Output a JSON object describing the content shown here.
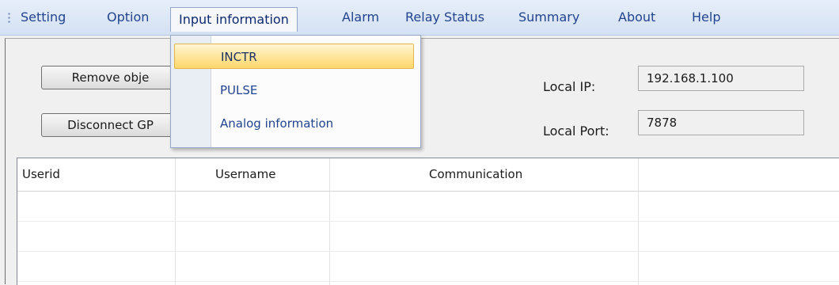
{
  "menubar": {
    "items": [
      "Setting",
      "Option",
      "Input information",
      "Alarm",
      "Relay Status",
      "Summary",
      "About",
      "Help"
    ]
  },
  "dropdown": {
    "items": [
      "INCTR",
      "PULSE",
      "Analog information"
    ],
    "highlighted": "INCTR"
  },
  "toolbar": {
    "remove_button": "Remove  obje",
    "disconnect_button": "Disconnect GP"
  },
  "network": {
    "local_ip_label": "Local   IP:",
    "local_ip_value": "192.168.1.100",
    "local_port_label": "Local Port:",
    "local_port_value": "7878"
  },
  "grid": {
    "columns": [
      "Userid",
      "Username",
      "Communication",
      ""
    ],
    "rows": [
      [
        "",
        "",
        "",
        ""
      ],
      [
        "",
        "",
        "",
        ""
      ],
      [
        "",
        "",
        "",
        ""
      ]
    ]
  },
  "colors": {
    "menubar": "#dce7f6",
    "menu_text": "#22448f",
    "highlight": "#ffd76c"
  }
}
